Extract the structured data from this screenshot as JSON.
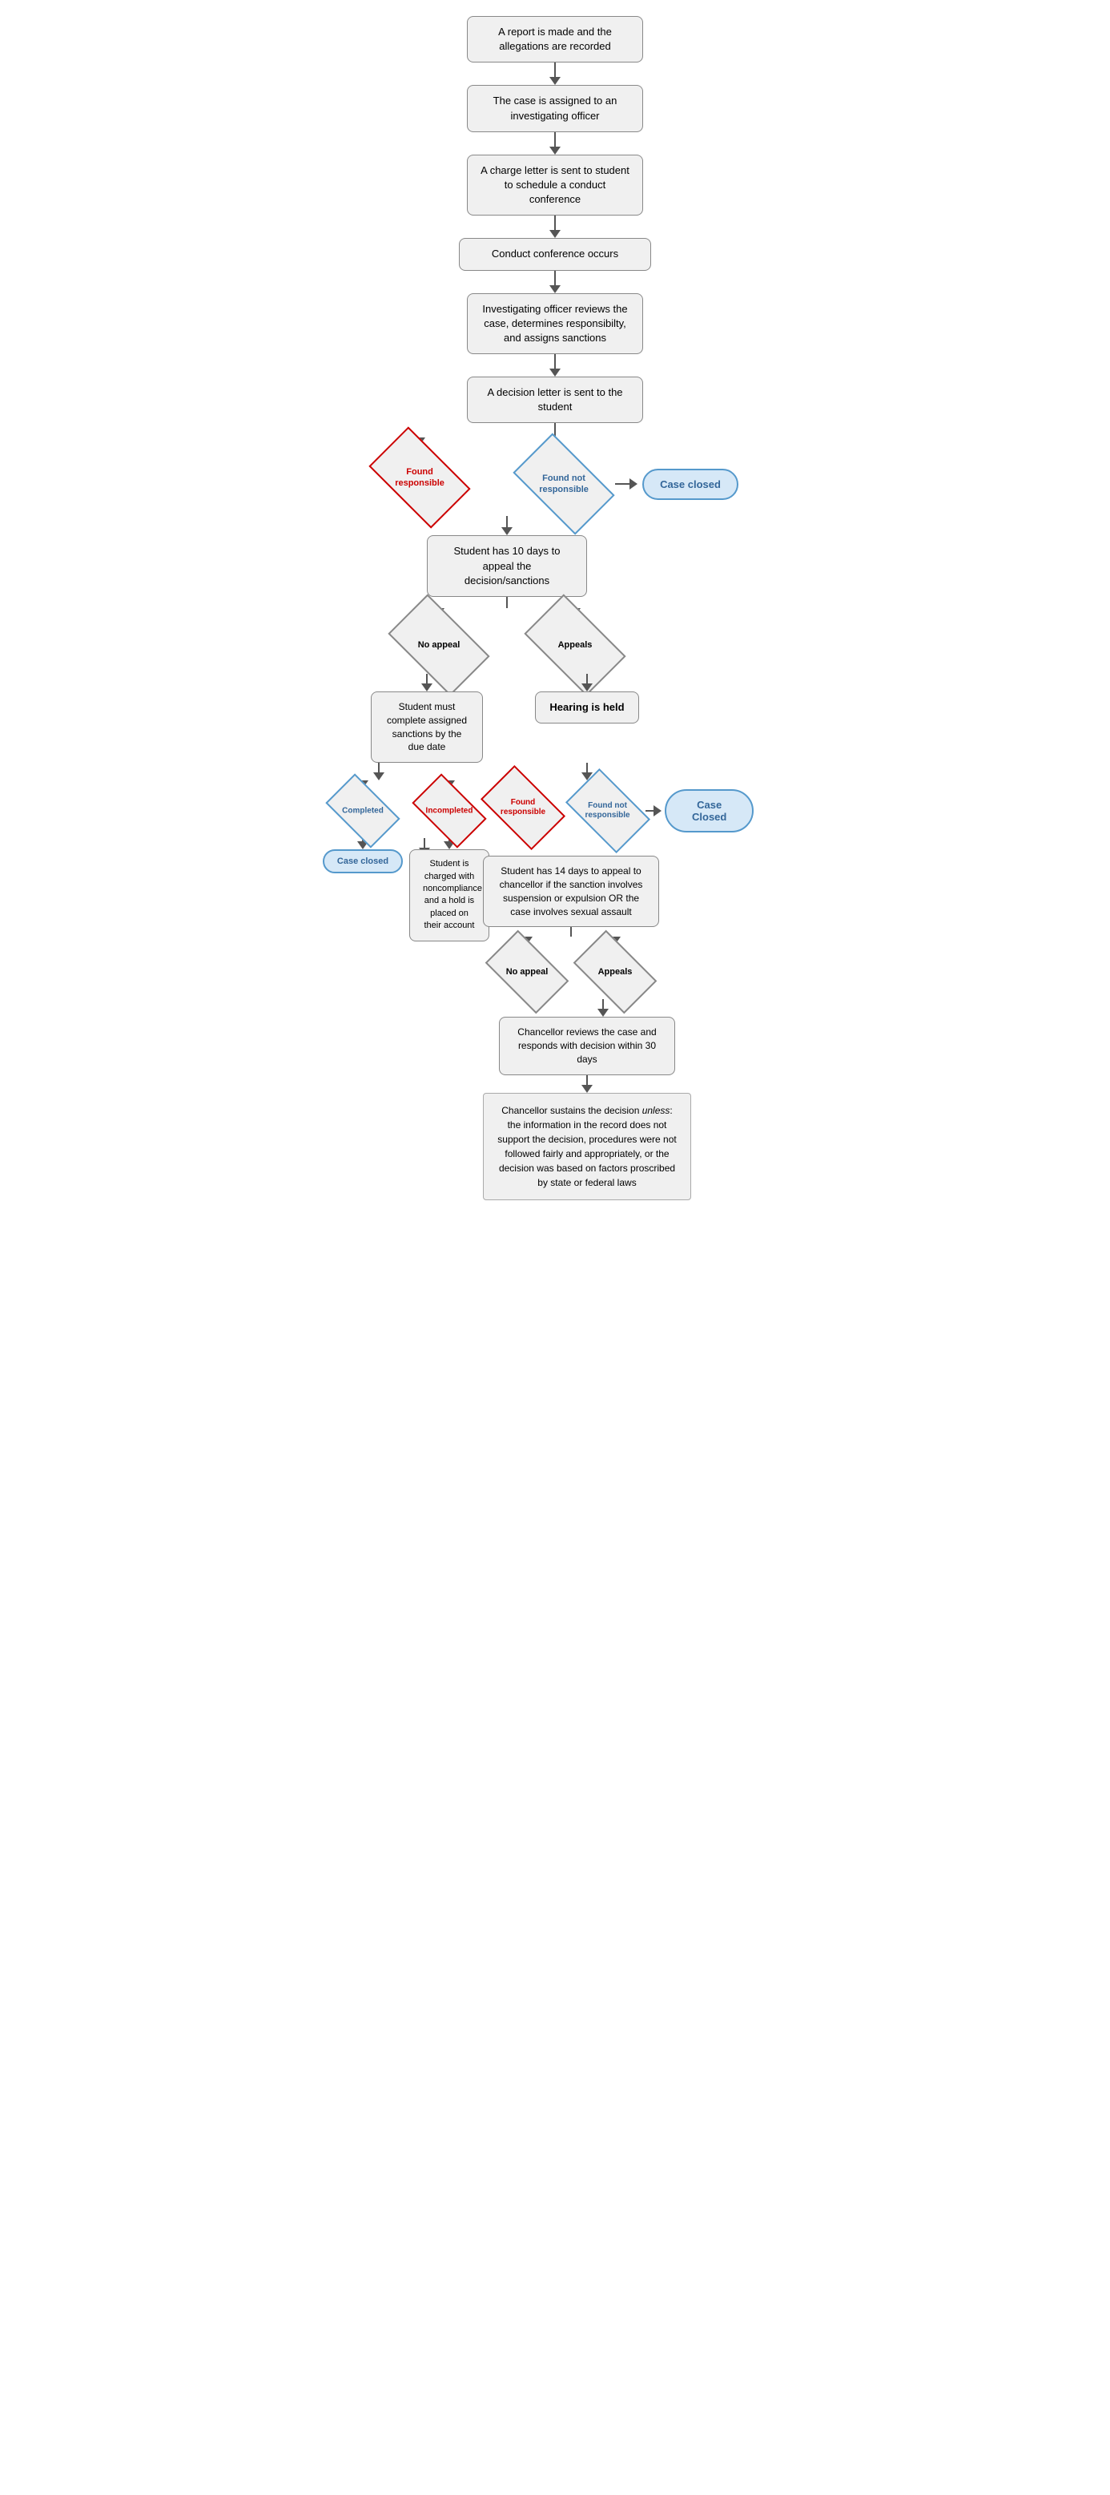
{
  "nodes": {
    "report": "A report is made and the allegations are recorded",
    "assigned": "The case is assigned to an investigating officer",
    "charge_letter": "A charge letter is sent to student to schedule a conduct conference",
    "conduct_conf": "Conduct conference occurs",
    "io_reviews": "Investigating officer reviews the case, determines responsibilty, and assigns sanctions",
    "decision_letter": "A decision letter is sent to the student",
    "found_responsible_1": "Found responsible",
    "found_not_responsible_1": "Found not responsible",
    "case_closed_1": "Case closed",
    "student_10_days": "Student has 10 days to appeal the decision/sanctions",
    "no_appeal_1": "No appeal",
    "appeals_1": "Appeals",
    "student_complete": "Student must complete assigned sanctions by the due date",
    "hearing_held": "Hearing is held",
    "completed": "Completed",
    "incompleted": "Incompleted",
    "case_closed_bottom": "Case closed",
    "found_responsible_2": "Found responsible",
    "found_not_responsible_2": "Found not responsible",
    "case_closed_2": "Case Closed",
    "student_charged": "Student is charged with noncompliance and a hold is placed on their account",
    "student_14_days": "Student has 14 days to appeal to chancellor if the sanction involves suspension or expulsion OR the case involves sexual assault",
    "no_appeal_2": "No appeal",
    "appeals_2": "Appeals",
    "chancellor_reviews": "Chancellor reviews the case and responds with decision within 30 days",
    "chancellor_sustains": "Chancellor sustains the decision unless: the information in the record does not support the decision, procedures were not followed fairly and appropriately, or the decision was based on factors proscribed by state or federal laws"
  }
}
